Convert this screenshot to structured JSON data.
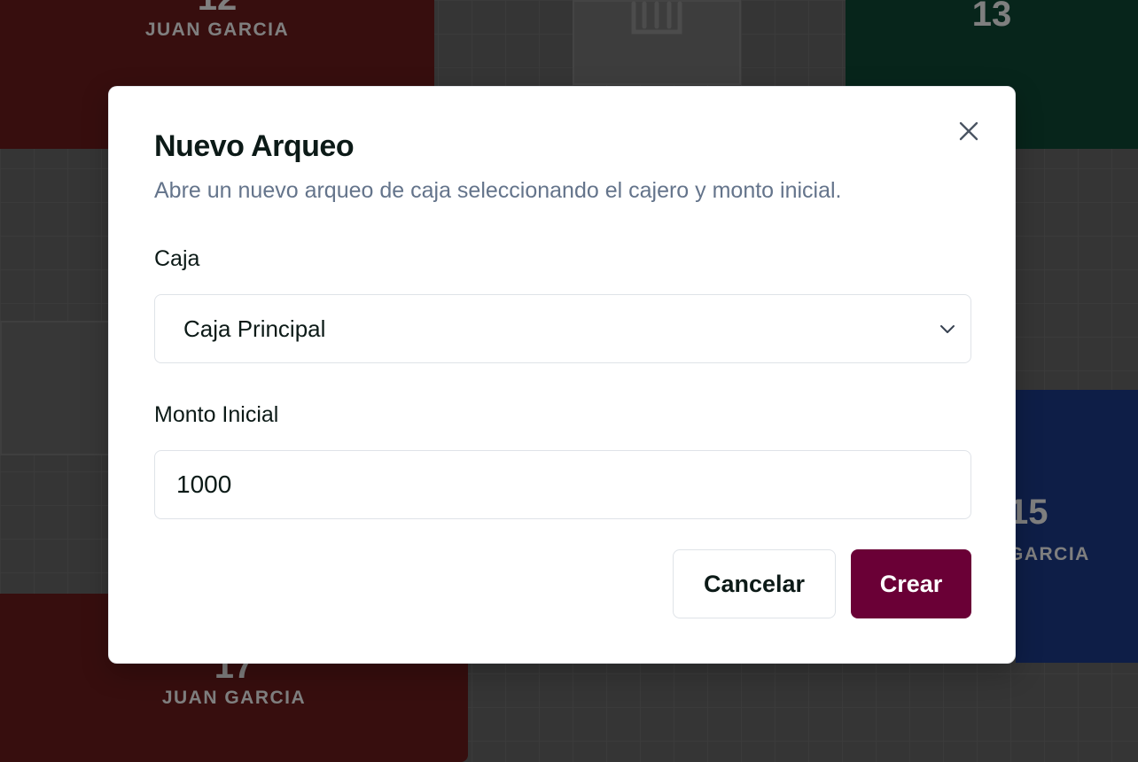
{
  "background": {
    "tiles": [
      {
        "number": "12",
        "owner": "JUAN GARCIA"
      },
      {
        "number": "13",
        "owner": ""
      },
      {
        "number": "17",
        "owner": "JUAN GARCIA"
      },
      {
        "number": "15",
        "owner": "GARCIA"
      }
    ]
  },
  "modal": {
    "title": "Nuevo Arqueo",
    "subtitle": "Abre un nuevo arqueo de caja seleccionando el cajero y monto inicial.",
    "caja": {
      "label": "Caja",
      "selected": "Caja Principal"
    },
    "monto": {
      "label": "Monto Inicial",
      "value": "1000"
    },
    "buttons": {
      "cancel": "Cancelar",
      "create": "Crear"
    }
  },
  "colors": {
    "primary": "#6a0036",
    "title": "#0c1a17",
    "muted": "#64748b"
  }
}
